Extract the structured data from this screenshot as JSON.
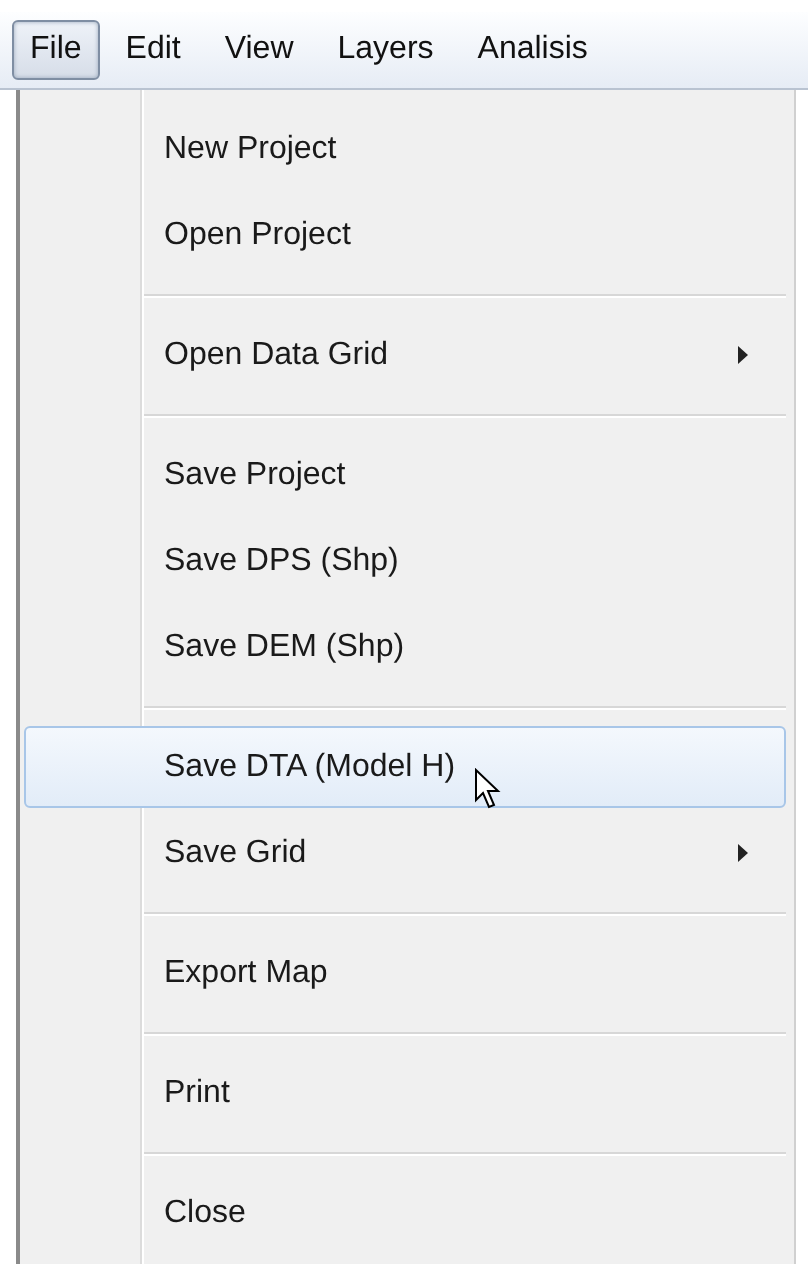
{
  "menu_bar": [
    {
      "label": "File",
      "selected": true
    },
    {
      "label": "Edit",
      "selected": false
    },
    {
      "label": "View",
      "selected": false
    },
    {
      "label": "Layers",
      "selected": false
    },
    {
      "label": "Analisis",
      "selected": false
    }
  ],
  "menu": {
    "items": [
      {
        "kind": "item",
        "label": "New Project",
        "selected": false,
        "submenu": false
      },
      {
        "kind": "item",
        "label": "Open Project",
        "selected": false,
        "submenu": false
      },
      {
        "kind": "separator"
      },
      {
        "kind": "item",
        "label": "Open Data Grid",
        "selected": false,
        "submenu": true
      },
      {
        "kind": "separator"
      },
      {
        "kind": "item",
        "label": "Save Project",
        "selected": false,
        "submenu": false
      },
      {
        "kind": "item",
        "label": "Save DPS (Shp)",
        "selected": false,
        "submenu": false
      },
      {
        "kind": "item",
        "label": "Save DEM (Shp)",
        "selected": false,
        "submenu": false
      },
      {
        "kind": "separator"
      },
      {
        "kind": "item",
        "label": "Save DTA (Model H)",
        "selected": true,
        "submenu": false
      },
      {
        "kind": "item",
        "label": "Save Grid",
        "selected": false,
        "submenu": true
      },
      {
        "kind": "separator"
      },
      {
        "kind": "item",
        "label": "Export Map",
        "selected": false,
        "submenu": false
      },
      {
        "kind": "separator"
      },
      {
        "kind": "item",
        "label": "Print",
        "selected": false,
        "submenu": false
      },
      {
        "kind": "separator"
      },
      {
        "kind": "item",
        "label": "Close",
        "selected": false,
        "submenu": false
      }
    ]
  }
}
